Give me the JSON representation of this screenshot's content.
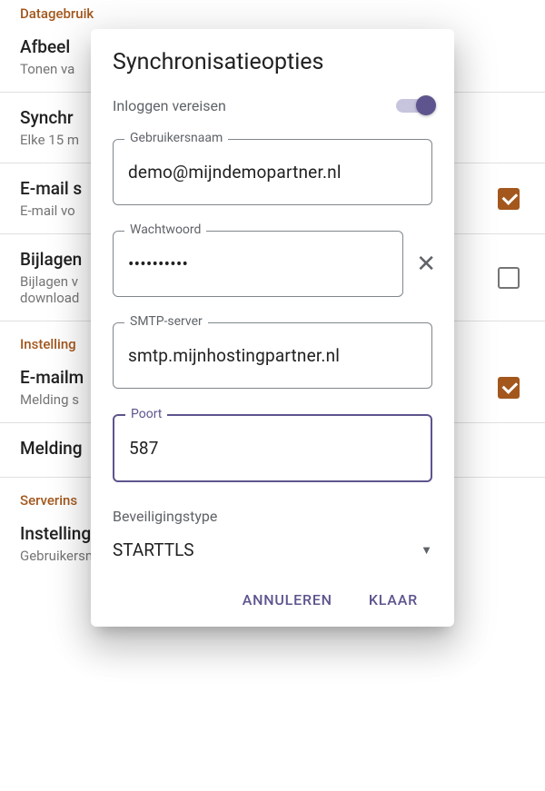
{
  "background": {
    "section1_header": "Datagebruik",
    "item1_title": "Afbeel",
    "item1_sub": "Tonen va",
    "item2_title": "Synchr",
    "item2_sub": "Elke 15 m",
    "item3_title": "E-mail s",
    "item3_sub": "E-mail vo",
    "item4_title": "Bijlagen",
    "item4_sub": "Bijlagen v",
    "item4_sub2": "download",
    "section2_header": "Instelling",
    "item5_title": "E-mailm",
    "item5_sub": "Melding s",
    "item6_title": "Melding",
    "section3_header": "Serverins",
    "item7_title": "Instelling",
    "item7_sub": "Gebruikersnaam, wachtwoord en andere inst. voor inkomende server"
  },
  "dialog": {
    "title": "Synchronisatieopties",
    "require_signin": "Inloggen vereisen",
    "username_label": "Gebruikersnaam",
    "username_value": "demo@mijndemopartner.nl",
    "password_label": "Wachtwoord",
    "password_value": "••••••••••",
    "smtp_label": "SMTP-server",
    "smtp_value": "smtp.mijnhostingpartner.nl",
    "port_label": "Poort",
    "port_value": "587",
    "security_label": "Beveiligingstype",
    "security_value": "STARTTLS",
    "cancel": "ANNULEREN",
    "done": "KLAAR"
  }
}
